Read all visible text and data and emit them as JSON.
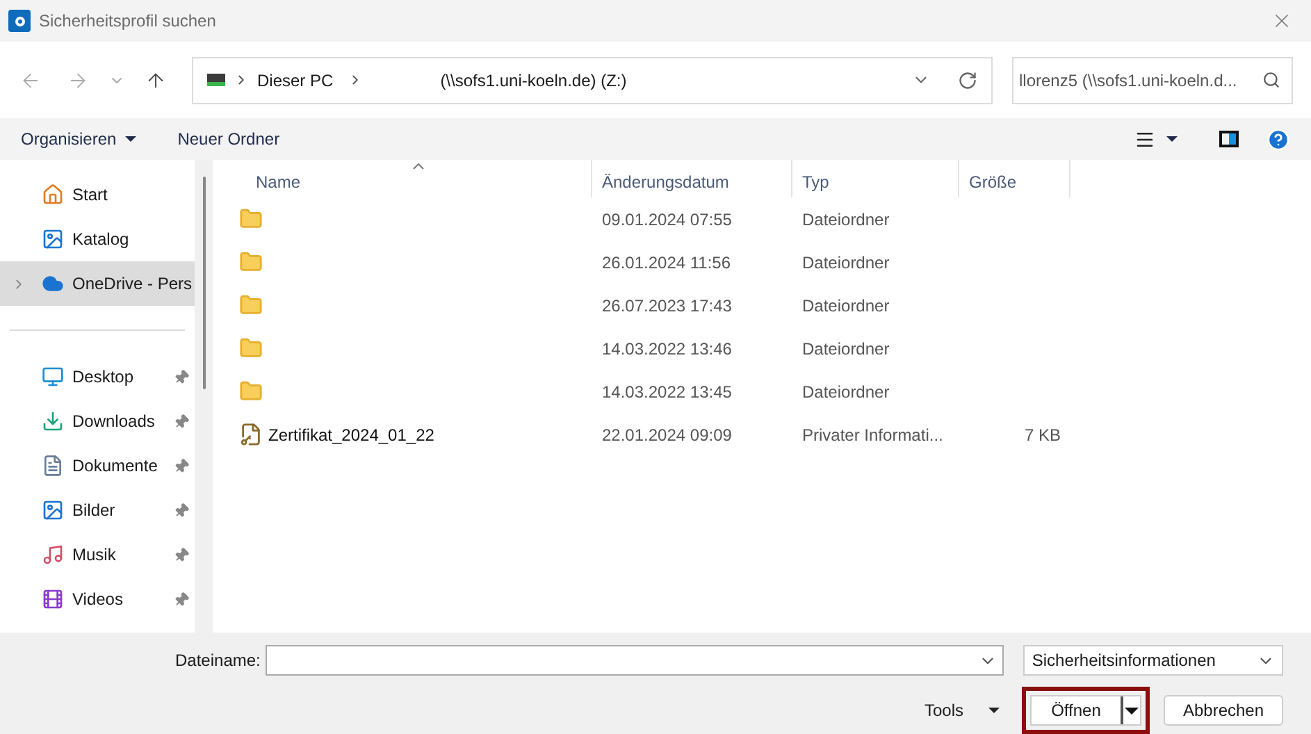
{
  "window": {
    "title": "Sicherheitsprofil suchen"
  },
  "address_bar": {
    "segments": [
      "Dieser PC",
      "(\\\\sofs1.uni-koeln.de) (Z:)"
    ]
  },
  "search": {
    "placeholder": "llorenz5 (\\\\sofs1.uni-koeln.d..."
  },
  "toolbar": {
    "organize": "Organisieren",
    "new_folder": "Neuer Ordner"
  },
  "sidebar": {
    "items": [
      {
        "label": "Start",
        "kind": "home",
        "selected": false,
        "pinned": false,
        "expandable": false
      },
      {
        "label": "Katalog",
        "kind": "gallery",
        "selected": false,
        "pinned": false,
        "expandable": false
      },
      {
        "label": "OneDrive - Pers",
        "kind": "cloud",
        "selected": true,
        "pinned": false,
        "expandable": true
      },
      {
        "label": "Desktop",
        "kind": "desktop",
        "selected": false,
        "pinned": true,
        "expandable": false
      },
      {
        "label": "Downloads",
        "kind": "download",
        "selected": false,
        "pinned": true,
        "expandable": false
      },
      {
        "label": "Dokumente",
        "kind": "document",
        "selected": false,
        "pinned": true,
        "expandable": false
      },
      {
        "label": "Bilder",
        "kind": "picture",
        "selected": false,
        "pinned": true,
        "expandable": false
      },
      {
        "label": "Musik",
        "kind": "music",
        "selected": false,
        "pinned": true,
        "expandable": false
      },
      {
        "label": "Videos",
        "kind": "video",
        "selected": false,
        "pinned": true,
        "expandable": false
      }
    ]
  },
  "table": {
    "columns": [
      "Name",
      "Änderungsdatum",
      "Typ",
      "Größe"
    ],
    "rows": [
      {
        "kind": "folder",
        "date": "09.01.2024 07:55",
        "type": "Dateiordner"
      },
      {
        "kind": "folder",
        "date": "26.01.2024 11:56",
        "type": "Dateiordner"
      },
      {
        "kind": "folder",
        "date": "26.07.2023 17:43",
        "type": "Dateiordner"
      },
      {
        "kind": "folder",
        "date": "14.03.2022 13:46",
        "type": "Dateiordner"
      },
      {
        "kind": "folder",
        "date": "14.03.2022 13:45",
        "type": "Dateiordner"
      },
      {
        "kind": "certificate",
        "name": "Zertifikat_2024_01_22",
        "date": "22.01.2024 09:09",
        "type": "Privater Informati...",
        "size": "7 KB"
      }
    ]
  },
  "footer": {
    "filename_label": "Dateiname:",
    "file_type": "Sicherheitsinformationen",
    "tools": "Tools",
    "open": "Öffnen",
    "cancel": "Abbrechen",
    "open_highlighted": true
  }
}
